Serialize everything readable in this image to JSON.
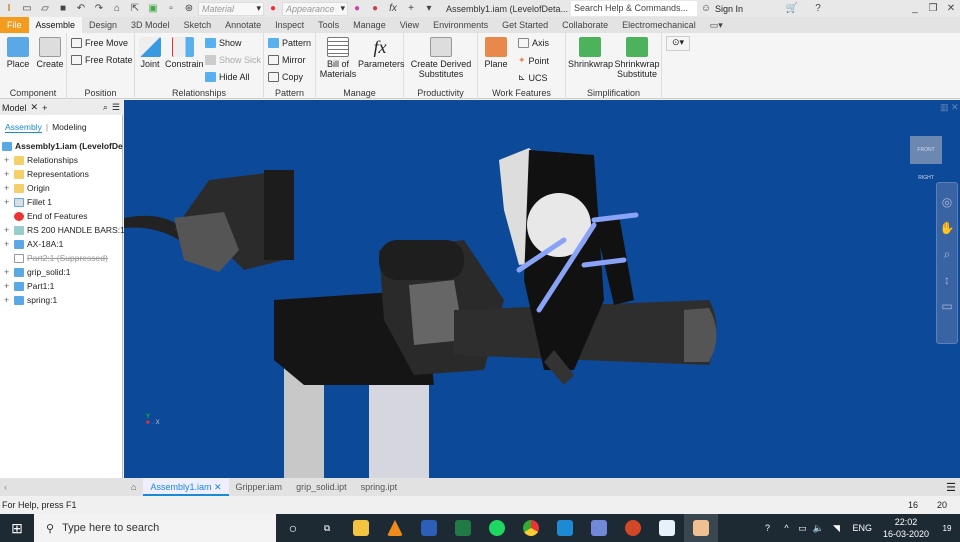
{
  "qat": {
    "material": "Material",
    "appearance": "Appearance",
    "doc_title": "Assembly1.iam (LevelofDeta...",
    "search_placeholder": "Search Help & Commands...",
    "sign_in": "Sign In"
  },
  "tabs": [
    "File",
    "Assemble",
    "Design",
    "3D Model",
    "Sketch",
    "Annotate",
    "Inspect",
    "Tools",
    "Manage",
    "View",
    "Environments",
    "Get Started",
    "Collaborate",
    "Electromechanical"
  ],
  "ribbon": {
    "component": {
      "label": "Component",
      "place": "Place",
      "create": "Create"
    },
    "position": {
      "label": "Position",
      "free_move": "Free Move",
      "free_rotate": "Free Rotate"
    },
    "relationships": {
      "label": "Relationships",
      "joint": "Joint",
      "constrain": "Constrain",
      "show": "Show",
      "show_sick": "Show Sick",
      "hide_all": "Hide All"
    },
    "pattern": {
      "label": "Pattern",
      "pattern": "Pattern",
      "mirror": "Mirror",
      "copy": "Copy"
    },
    "manage": {
      "label": "Manage",
      "bom1": "Bill of",
      "bom2": "Materials",
      "parameters": "Parameters"
    },
    "productivity": {
      "label": "Productivity",
      "cds1": "Create Derived",
      "cds2": "Substitutes"
    },
    "work_features": {
      "label": "Work Features",
      "plane": "Plane",
      "axis": "Axis",
      "point": "Point",
      "ucs": "UCS"
    },
    "simplification": {
      "label": "Simplification",
      "shrinkwrap": "Shrinkwrap",
      "ss1": "Shrinkwrap",
      "ss2": "Substitute"
    }
  },
  "browser": {
    "title": "Model",
    "tab_assembly": "Assembly",
    "tab_modeling": "Modeling",
    "root": "Assembly1.iam (LevelofDe",
    "items": [
      {
        "label": "Relationships"
      },
      {
        "label": "Representations"
      },
      {
        "label": "Origin"
      },
      {
        "label": "Fillet 1"
      },
      {
        "label": "End of Features"
      },
      {
        "label": "RS 200 HANDLE BARS:1"
      },
      {
        "label": "AX-18A:1"
      },
      {
        "label": "Part2:1 (Suppressed)"
      },
      {
        "label": "grip_solid:1"
      },
      {
        "label": "Part1:1"
      },
      {
        "label": "spring:1"
      }
    ]
  },
  "viewcube": {
    "face_right": "RIGHT",
    "face_front": "FRONT"
  },
  "doc_tabs": [
    "Assembly1.iam",
    "Gripper.iam",
    "grip_solid.ipt",
    "spring.ipt"
  ],
  "status": {
    "help": "For Help, press F1",
    "count1": "16",
    "count2": "20"
  },
  "taskbar": {
    "search": "Type here to search",
    "lang": "ENG",
    "time": "22:02",
    "date": "16-03-2020",
    "notifications": "19"
  },
  "colors": {
    "file_tab": "#f29b1f",
    "viewport": "#0c4a99",
    "accent": "#1a8ad4"
  }
}
